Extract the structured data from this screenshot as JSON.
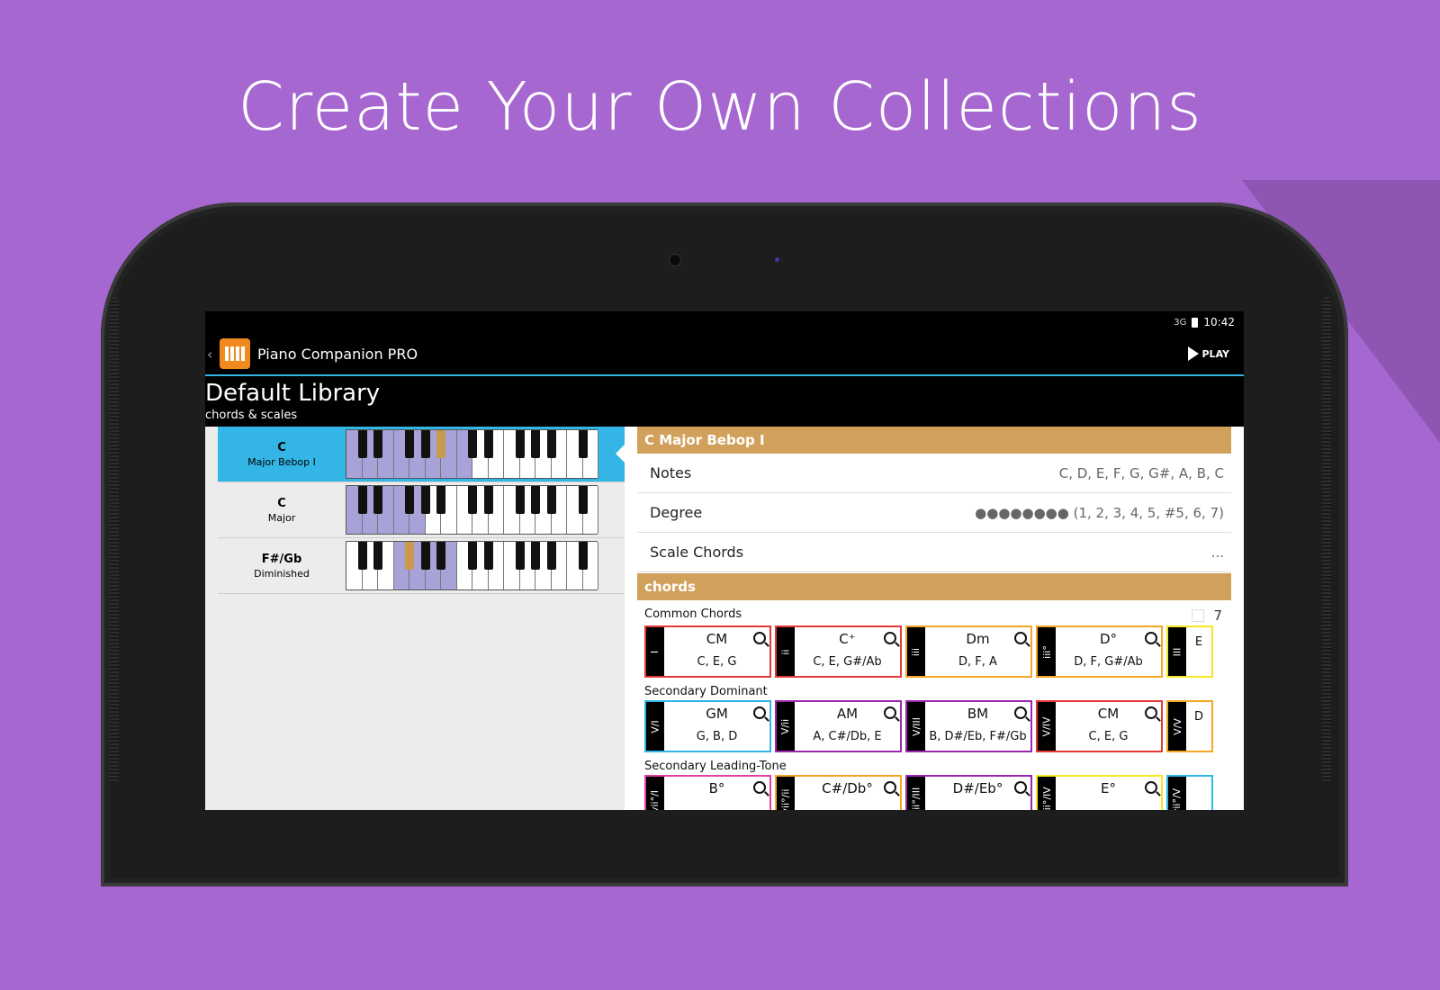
{
  "headline": "Create Your Own Collections",
  "status": {
    "time": "10:42",
    "signal": "3G"
  },
  "actionbar": {
    "app_title": "Piano Companion PRO",
    "play_label": "PLAY"
  },
  "library": {
    "title": "Default Library",
    "subtitle": "chords & scales"
  },
  "list": [
    {
      "name": "C",
      "type": "Major Bebop I",
      "selected": true
    },
    {
      "name": "C",
      "type": "Major",
      "selected": false
    },
    {
      "name": "F#/Gb",
      "type": "Diminished",
      "selected": false
    }
  ],
  "detail": {
    "title": "C Major Bebop I",
    "rows": [
      {
        "key": "Notes",
        "value": "C, D, E, F, G, G#, A, B, C"
      },
      {
        "key": "Degree",
        "value": "●●●●●●●● (1, 2, 3, 4, 5, #5, 6, 7)"
      },
      {
        "key": "Scale Chords",
        "value": "..."
      }
    ],
    "chords_label": "chords",
    "count": "7"
  },
  "groups": [
    {
      "label": "Common Chords",
      "cards": [
        {
          "tab": "I",
          "name": "CM",
          "notes": "C, E, G",
          "color": "#e53935"
        },
        {
          "tab": "ii",
          "name": "C⁺",
          "notes": "C, E, G#/Ab",
          "color": "#e53935"
        },
        {
          "tab": "iii",
          "name": "Dm",
          "notes": "D, F, A",
          "color": "#f5a623"
        },
        {
          "tab": "iii°",
          "name": "D°",
          "notes": "D, F, G#/Ab",
          "color": "#f5a623"
        },
        {
          "tab": "III",
          "name": "",
          "notes": "E",
          "color": "#f5e623"
        }
      ]
    },
    {
      "label": "Secondary Dominant",
      "cards": [
        {
          "tab": "V/I",
          "name": "GM",
          "notes": "G, B, D",
          "color": "#33b5e5"
        },
        {
          "tab": "V/ii",
          "name": "AM",
          "notes": "A, C#/Db, E",
          "color": "#9c27b0"
        },
        {
          "tab": "V/III",
          "name": "BM",
          "notes": "B, D#/Eb, F#/Gb",
          "color": "#9c27b0"
        },
        {
          "tab": "V/IV",
          "name": "CM",
          "notes": "C, E, G",
          "color": "#e53935"
        },
        {
          "tab": "V/V",
          "name": "",
          "notes": "D",
          "color": "#f5a623"
        }
      ]
    },
    {
      "label": "Secondary Leading-Tone",
      "cards": [
        {
          "tab": "vii°/I",
          "name": "B°",
          "notes": "",
          "color": "#e040a0"
        },
        {
          "tab": "vii°/ii",
          "name": "C#/Db°",
          "notes": "",
          "color": "#f5a623"
        },
        {
          "tab": "vii°/III",
          "name": "D#/Eb°",
          "notes": "",
          "color": "#9c27b0"
        },
        {
          "tab": "vii°/IV",
          "name": "E°",
          "notes": "",
          "color": "#f5e623"
        },
        {
          "tab": "vii°/V",
          "name": "",
          "notes": "",
          "color": "#33b5e5"
        }
      ]
    }
  ]
}
